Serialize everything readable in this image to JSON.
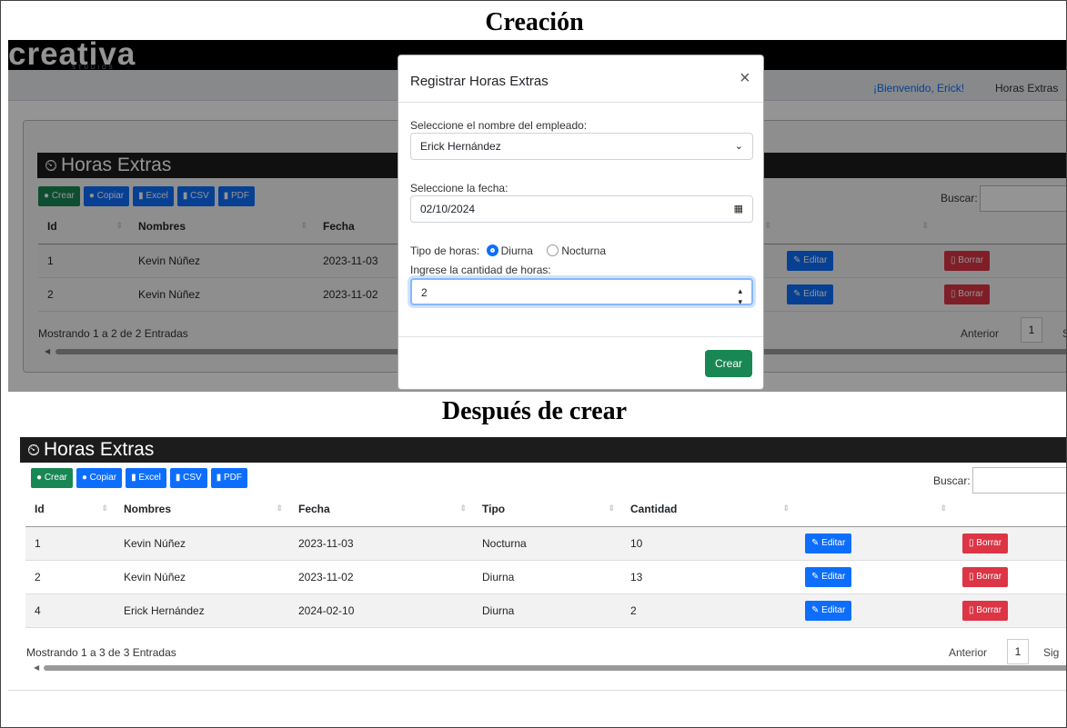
{
  "headings": {
    "top": "Creación",
    "middle": "Después de crear"
  },
  "app": {
    "logo": "creativa",
    "logo_sub": "STUDIOS",
    "welcome": "¡Bienvenido, Erick!",
    "nav_tab": "Horas Extras"
  },
  "section_title": "Horas Extras",
  "buttons": {
    "crear": "Crear",
    "copiar": "Copiar",
    "excel": "Excel",
    "csv": "CSV",
    "pdf": "PDF"
  },
  "search_label": "Buscar:",
  "columns": [
    "Id",
    "Nombres",
    "Fecha",
    "Tipo",
    "Cantidad"
  ],
  "row_buttons": {
    "edit": "Editar",
    "delete": "Borrar"
  },
  "table_before": {
    "rows": [
      {
        "id": "1",
        "nombre": "Kevin Núñez",
        "fecha": "2023-11-03"
      },
      {
        "id": "2",
        "nombre": "Kevin Núñez",
        "fecha": "2023-11-02"
      }
    ],
    "info": "Mostrando 1 a 2 de 2 Entradas",
    "prev": "Anterior",
    "page": "1",
    "next": "S"
  },
  "modal": {
    "title": "Registrar Horas Extras",
    "close": "×",
    "employee_label": "Seleccione el nombre del empleado:",
    "employee_value": "Erick Hernández",
    "date_label": "Seleccione la fecha:",
    "date_value": "02/10/2024",
    "type_label": "Tipo de horas:",
    "type_options": [
      "Diurna",
      "Nocturna"
    ],
    "type_selected": "Diurna",
    "hours_label": "Ingrese la cantidad de horas:",
    "hours_value": "2",
    "submit": "Crear"
  },
  "table_after": {
    "rows": [
      {
        "id": "1",
        "nombre": "Kevin Núñez",
        "fecha": "2023-11-03",
        "tipo": "Nocturna",
        "cantidad": "10"
      },
      {
        "id": "2",
        "nombre": "Kevin Núñez",
        "fecha": "2023-11-02",
        "tipo": "Diurna",
        "cantidad": "13"
      },
      {
        "id": "4",
        "nombre": "Erick Hernández",
        "fecha": "2024-02-10",
        "tipo": "Diurna",
        "cantidad": "2"
      }
    ],
    "info": "Mostrando 1 a 3 de 3 Entradas",
    "prev": "Anterior",
    "page": "1",
    "next": "Sig"
  },
  "icons": {
    "title": "clock-icon",
    "crear": "plus-circle-icon",
    "copiar": "plus-circle-icon",
    "excel": "file-excel-icon",
    "csv": "file-csv-icon",
    "pdf": "file-pdf-icon",
    "edit": "edit-icon",
    "delete": "trash-icon",
    "calendar": "calendar-icon",
    "select": "chevron-down-icon",
    "spinner": "stepper-icon"
  },
  "colors": {
    "green": "#198754",
    "blue": "#0d6efd",
    "red": "#dc3545",
    "dark": "#1c1c1c"
  }
}
